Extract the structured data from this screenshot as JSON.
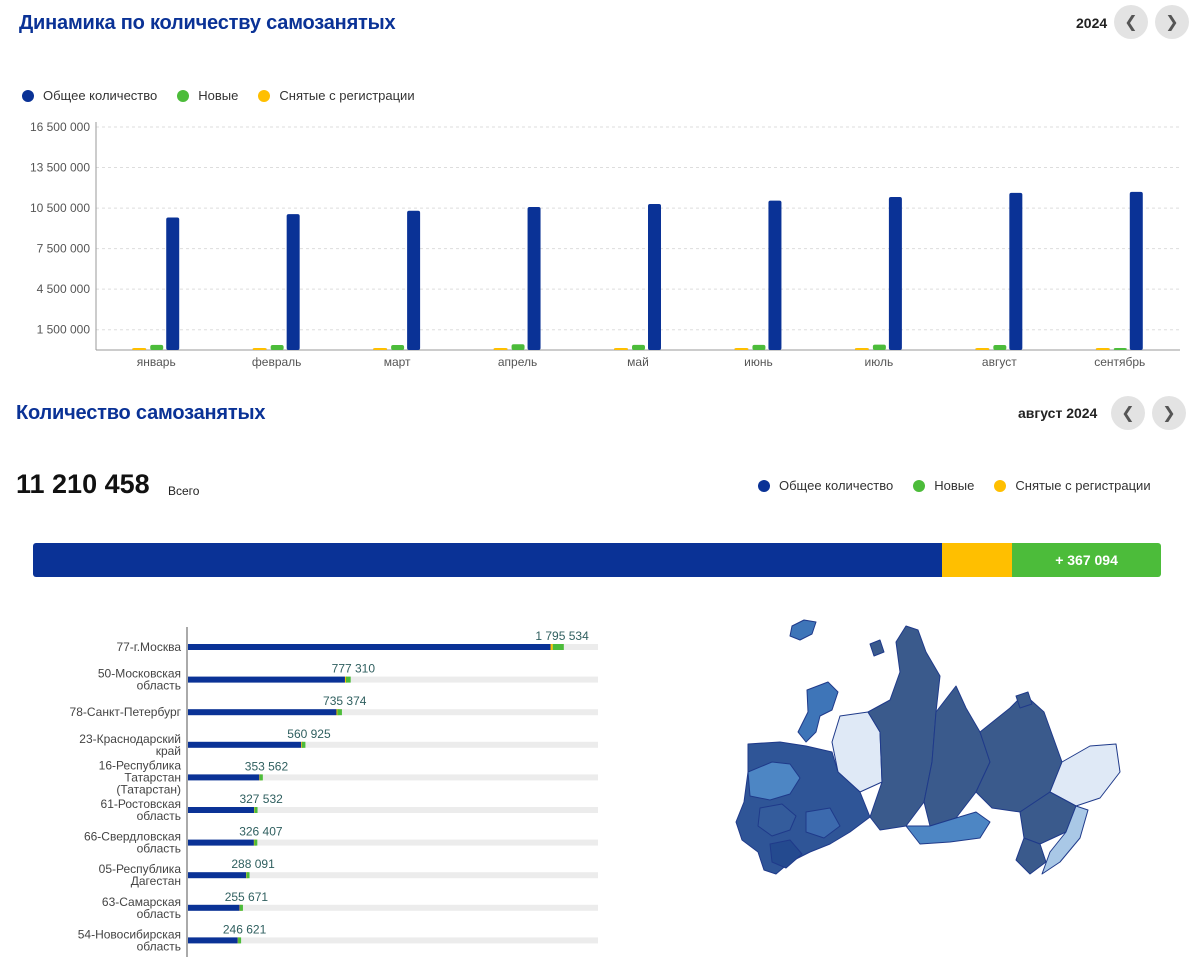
{
  "dynamics": {
    "title": "Динамика по количеству самозанятых",
    "year": "2024",
    "prev_icon": "chevron-left-icon",
    "next_icon": "chevron-right-icon",
    "legend": [
      "Общее количество",
      "Новые",
      "Снятые с регистрации"
    ]
  },
  "colors": {
    "total": "#0a3296",
    "new": "#4cbc3a",
    "removed": "#ffbf00",
    "grid": "#dddddd"
  },
  "chart_data": [
    {
      "type": "bar",
      "categories": [
        "январь",
        "февраль",
        "март",
        "апрель",
        "май",
        "июнь",
        "июль",
        "август",
        "сентябрь"
      ],
      "series": [
        {
          "name": "Снятые с регистрации",
          "values": [
            140000,
            120000,
            130000,
            120000,
            120000,
            110000,
            100000,
            130000,
            40000
          ]
        },
        {
          "name": "Новые",
          "values": [
            380000,
            370000,
            370000,
            430000,
            380000,
            380000,
            400000,
            367094,
            70000
          ]
        },
        {
          "name": "Общее количество",
          "values": [
            9800000,
            10050000,
            10300000,
            10580000,
            10800000,
            11050000,
            11320000,
            11630000,
            11700000
          ]
        }
      ],
      "yticks": [
        "1 500 000",
        "4 500 000",
        "7 500 000",
        "10 500 000",
        "13 500 000",
        "16 500 000"
      ],
      "ytick_values": [
        1500000,
        4500000,
        7500000,
        10500000,
        13500000,
        16500000
      ],
      "ylim": [
        0,
        16500000
      ],
      "grid": true,
      "legend_position": "top-left"
    },
    {
      "type": "bar",
      "categories": [
        "77-г.Москва",
        "50-Московская область",
        "78-Санкт-Петербург",
        "23-Краснодарский край",
        "16-Республика Татарстан (Татарстан)",
        "61-Ростовская область",
        "66-Свердловская область",
        "05-Республика Дагестан",
        "63-Самарская область",
        "54-Новосибирская область"
      ],
      "values": [
        1795534,
        777310,
        735374,
        560925,
        353562,
        327532,
        326407,
        288091,
        255671,
        246621
      ],
      "labels": [
        "1 795 534",
        "777 310",
        "735 374",
        "560 925",
        "353 562",
        "327 532",
        "326 407",
        "288 091",
        "255 671",
        "246 621"
      ],
      "xlim": [
        0,
        2000000
      ],
      "orientation": "horizontal"
    }
  ],
  "count": {
    "title": "Количество самозанятых",
    "period": "август 2024",
    "total": "11 210 458",
    "total_label": "Всего",
    "legend": [
      "Общее количество",
      "Новые",
      "Снятые с регистрации"
    ],
    "new_label": "+ 367 094",
    "bar_shares": {
      "total": 0.806,
      "removed": 0.062,
      "new": 0.132
    }
  },
  "map": {
    "icon": "russia-regions-map"
  }
}
